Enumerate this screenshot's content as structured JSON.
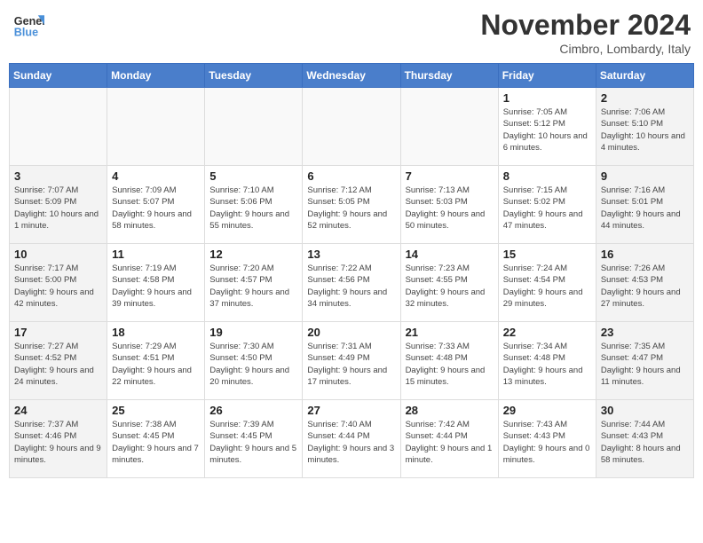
{
  "header": {
    "logo_general": "General",
    "logo_blue": "Blue",
    "month": "November 2024",
    "location": "Cimbro, Lombardy, Italy"
  },
  "days_of_week": [
    "Sunday",
    "Monday",
    "Tuesday",
    "Wednesday",
    "Thursday",
    "Friday",
    "Saturday"
  ],
  "weeks": [
    [
      {
        "day": "",
        "info": "",
        "empty": true
      },
      {
        "day": "",
        "info": "",
        "empty": true
      },
      {
        "day": "",
        "info": "",
        "empty": true
      },
      {
        "day": "",
        "info": "",
        "empty": true
      },
      {
        "day": "",
        "info": "",
        "empty": true
      },
      {
        "day": "1",
        "info": "Sunrise: 7:05 AM\nSunset: 5:12 PM\nDaylight: 10 hours and 6 minutes."
      },
      {
        "day": "2",
        "info": "Sunrise: 7:06 AM\nSunset: 5:10 PM\nDaylight: 10 hours and 4 minutes.",
        "weekend": true
      }
    ],
    [
      {
        "day": "3",
        "info": "Sunrise: 7:07 AM\nSunset: 5:09 PM\nDaylight: 10 hours and 1 minute.",
        "weekend": true
      },
      {
        "day": "4",
        "info": "Sunrise: 7:09 AM\nSunset: 5:07 PM\nDaylight: 9 hours and 58 minutes."
      },
      {
        "day": "5",
        "info": "Sunrise: 7:10 AM\nSunset: 5:06 PM\nDaylight: 9 hours and 55 minutes."
      },
      {
        "day": "6",
        "info": "Sunrise: 7:12 AM\nSunset: 5:05 PM\nDaylight: 9 hours and 52 minutes."
      },
      {
        "day": "7",
        "info": "Sunrise: 7:13 AM\nSunset: 5:03 PM\nDaylight: 9 hours and 50 minutes."
      },
      {
        "day": "8",
        "info": "Sunrise: 7:15 AM\nSunset: 5:02 PM\nDaylight: 9 hours and 47 minutes."
      },
      {
        "day": "9",
        "info": "Sunrise: 7:16 AM\nSunset: 5:01 PM\nDaylight: 9 hours and 44 minutes.",
        "weekend": true
      }
    ],
    [
      {
        "day": "10",
        "info": "Sunrise: 7:17 AM\nSunset: 5:00 PM\nDaylight: 9 hours and 42 minutes.",
        "weekend": true
      },
      {
        "day": "11",
        "info": "Sunrise: 7:19 AM\nSunset: 4:58 PM\nDaylight: 9 hours and 39 minutes."
      },
      {
        "day": "12",
        "info": "Sunrise: 7:20 AM\nSunset: 4:57 PM\nDaylight: 9 hours and 37 minutes."
      },
      {
        "day": "13",
        "info": "Sunrise: 7:22 AM\nSunset: 4:56 PM\nDaylight: 9 hours and 34 minutes."
      },
      {
        "day": "14",
        "info": "Sunrise: 7:23 AM\nSunset: 4:55 PM\nDaylight: 9 hours and 32 minutes."
      },
      {
        "day": "15",
        "info": "Sunrise: 7:24 AM\nSunset: 4:54 PM\nDaylight: 9 hours and 29 minutes."
      },
      {
        "day": "16",
        "info": "Sunrise: 7:26 AM\nSunset: 4:53 PM\nDaylight: 9 hours and 27 minutes.",
        "weekend": true
      }
    ],
    [
      {
        "day": "17",
        "info": "Sunrise: 7:27 AM\nSunset: 4:52 PM\nDaylight: 9 hours and 24 minutes.",
        "weekend": true
      },
      {
        "day": "18",
        "info": "Sunrise: 7:29 AM\nSunset: 4:51 PM\nDaylight: 9 hours and 22 minutes."
      },
      {
        "day": "19",
        "info": "Sunrise: 7:30 AM\nSunset: 4:50 PM\nDaylight: 9 hours and 20 minutes."
      },
      {
        "day": "20",
        "info": "Sunrise: 7:31 AM\nSunset: 4:49 PM\nDaylight: 9 hours and 17 minutes."
      },
      {
        "day": "21",
        "info": "Sunrise: 7:33 AM\nSunset: 4:48 PM\nDaylight: 9 hours and 15 minutes."
      },
      {
        "day": "22",
        "info": "Sunrise: 7:34 AM\nSunset: 4:48 PM\nDaylight: 9 hours and 13 minutes."
      },
      {
        "day": "23",
        "info": "Sunrise: 7:35 AM\nSunset: 4:47 PM\nDaylight: 9 hours and 11 minutes.",
        "weekend": true
      }
    ],
    [
      {
        "day": "24",
        "info": "Sunrise: 7:37 AM\nSunset: 4:46 PM\nDaylight: 9 hours and 9 minutes.",
        "weekend": true
      },
      {
        "day": "25",
        "info": "Sunrise: 7:38 AM\nSunset: 4:45 PM\nDaylight: 9 hours and 7 minutes."
      },
      {
        "day": "26",
        "info": "Sunrise: 7:39 AM\nSunset: 4:45 PM\nDaylight: 9 hours and 5 minutes."
      },
      {
        "day": "27",
        "info": "Sunrise: 7:40 AM\nSunset: 4:44 PM\nDaylight: 9 hours and 3 minutes."
      },
      {
        "day": "28",
        "info": "Sunrise: 7:42 AM\nSunset: 4:44 PM\nDaylight: 9 hours and 1 minute."
      },
      {
        "day": "29",
        "info": "Sunrise: 7:43 AM\nSunset: 4:43 PM\nDaylight: 9 hours and 0 minutes."
      },
      {
        "day": "30",
        "info": "Sunrise: 7:44 AM\nSunset: 4:43 PM\nDaylight: 8 hours and 58 minutes.",
        "weekend": true
      }
    ]
  ]
}
